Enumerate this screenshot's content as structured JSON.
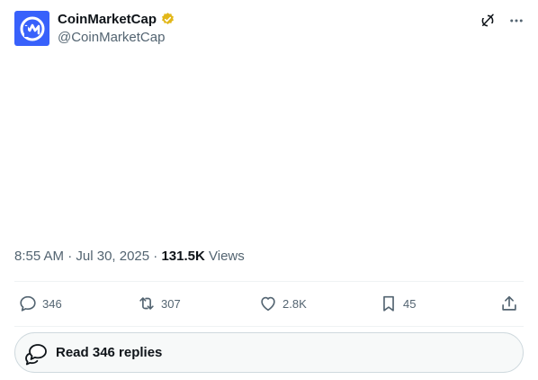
{
  "author": {
    "display_name": "CoinMarketCap",
    "handle": "@CoinMarketCap",
    "verified_icon": "verified-badge-gold",
    "avatar_color": "#3861fb"
  },
  "top_actions": {
    "grok_icon": "grok-icon",
    "more_icon": "more-icon"
  },
  "meta": {
    "time": "8:55 AM",
    "sep1": " · ",
    "date": "Jul 30, 2025",
    "sep2": " · ",
    "views_count": "131.5K",
    "views_label": " Views"
  },
  "actions": {
    "replies": "346",
    "reposts": "307",
    "likes": "2.8K",
    "bookmarks": "45"
  },
  "read_replies": {
    "label": "Read 346 replies"
  },
  "colors": {
    "text_primary": "#0f1419",
    "text_secondary": "#536471",
    "border": "#cfd9de",
    "verified": "#e2b719"
  }
}
